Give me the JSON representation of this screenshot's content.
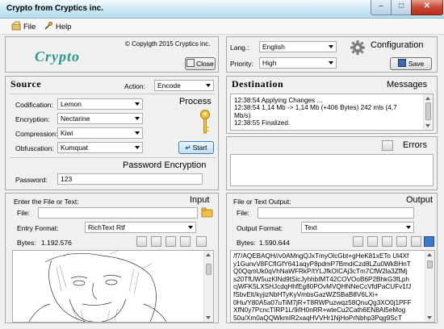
{
  "window": {
    "title": "Crypto from Cryptics inc.",
    "min_glyph": "–",
    "max_glyph": "□",
    "close_glyph": "✕"
  },
  "menu": {
    "file": "File",
    "help": "Help"
  },
  "brand": {
    "logo_text": "Crypto",
    "copyright": "© Copyigth 2015 Cryptics inc.",
    "close_label": "Close"
  },
  "config": {
    "lang_label": "Lang.:",
    "lang_value": "English",
    "priority_label": "Priority:",
    "priority_value": "High",
    "title": "Configuration",
    "save_label": "Save"
  },
  "source": {
    "title": "Source",
    "action_label": "Action:",
    "action_value": "Encode",
    "process_title": "Process",
    "codification_label": "Codification:",
    "codification_value": "Lemon",
    "encryption_label": "Encryption:",
    "encryption_value": "Nectarine",
    "compression_label": "Compression:",
    "compression_value": "Kiwi",
    "obfuscation_label": "Obfuscation:",
    "obfuscation_value": "Kumquat",
    "start_label": "Start",
    "password_title": "Password Encryption",
    "password_label": "Password:",
    "password_value": "123"
  },
  "input": {
    "prompt": "Enter the File or Text:",
    "title": "Input",
    "file_label": "File:",
    "file_value": "",
    "format_label": "Entry Format:",
    "format_value": "RichText Rtf",
    "bytes_label": "Bytes:",
    "bytes_value": "1.192.576"
  },
  "destination": {
    "title": "Destination",
    "messages_title": "Messages",
    "messages": [
      "12:38:54 Applying Changes ...",
      "12:38:54 1,14 Mb -> 1,14 Mb (+406 Bytes) 242 mls (4,7",
      "Mb/s)",
      "12:38:55 Finalized."
    ],
    "errors_title": "Errors"
  },
  "output": {
    "prompt": "File or Text Output:",
    "title": "Output",
    "file_label": "File:",
    "file_value": "",
    "format_label": "Output Format:",
    "format_value": "Text",
    "bytes_label": "Bytes:",
    "bytes_value": "1.590.644",
    "lines": [
      "/f7/AQEBAQH//v0AMngQJxTmyOlcGbt+gHeK81xETo Ul4Xf",
      "y1GunvV8FCfIGfY641aqyP8pdmP7BmdiCzd8LZu0WkBHnT",
      "Q0QqmUk0qVhNaWFRkP/tYLJfkOICAj3cTm7CfW2la3ZfMj",
      "s20TfUW5uzKlNd9tSicJyhhbIMT42COVOoB6P2BhkG3fLph",
      "cjWFK5LXSHJcdqHhfEg80POvMVQHNNeCcVfdPaCUFv1fJ",
      "fSbvElt/kyjizNbHTyKyVmbsGazWZSBaB8V6LXi+",
      "0Hu/Y80A5a07uTiM7jR+T8RWPuzwqz58QnuQg3XO0j1PFF",
      "XfN0y7PcncTIRP1L/9/lH0nRR+wteCu2Cath6EN8Al5eMog",
      "50u/Xm0aQQWkmIR2xaqHVVHr1NjHoPrNbhp3Pqg9ScT"
    ]
  },
  "colors": {
    "accent_teal": "#2a9a8a",
    "title_blue": "#1a3f7a",
    "titlebar": "#c9e7f3",
    "close_red": "#c74933"
  }
}
